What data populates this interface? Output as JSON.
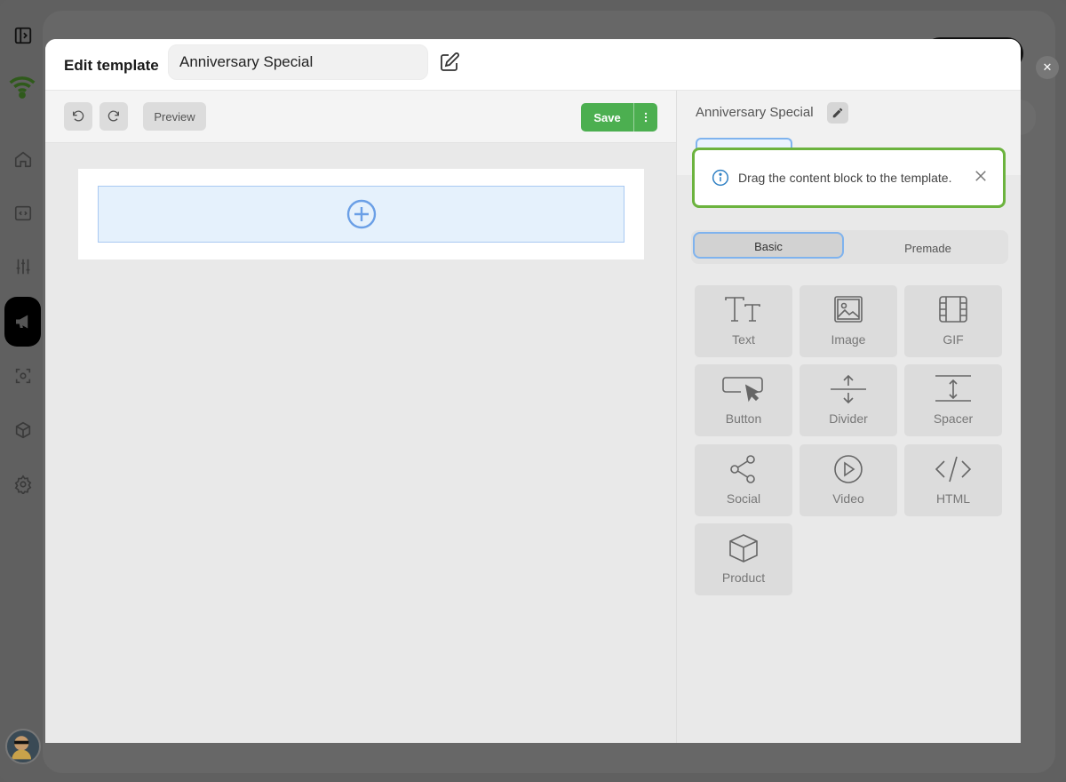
{
  "modal": {
    "title": "Edit template",
    "template_name": "Anniversary Special"
  },
  "toolbar": {
    "undo_icon": "undo-icon",
    "redo_icon": "redo-icon",
    "preview_label": "Preview",
    "save_label": "Save"
  },
  "panel": {
    "title": "Anniversary Special",
    "tabs": [
      {
        "label": "Basic",
        "selected": true
      },
      {
        "label": "Premade",
        "selected": false
      }
    ],
    "blocks": [
      {
        "label": "Text",
        "icon": "text-icon"
      },
      {
        "label": "Image",
        "icon": "image-icon"
      },
      {
        "label": "GIF",
        "icon": "gif-icon"
      },
      {
        "label": "Button",
        "icon": "button-icon"
      },
      {
        "label": "Divider",
        "icon": "divider-icon"
      },
      {
        "label": "Spacer",
        "icon": "spacer-icon"
      },
      {
        "label": "Social",
        "icon": "share-icon"
      },
      {
        "label": "Video",
        "icon": "play-icon"
      },
      {
        "label": "HTML",
        "icon": "code-icon"
      },
      {
        "label": "Product",
        "icon": "cube-icon"
      }
    ]
  },
  "hint": {
    "text": "Drag the content block to the template."
  },
  "colors": {
    "save_green": "#4caf50",
    "highlight_green": "#6cb33e",
    "accent_blue": "#7fb3ee"
  }
}
